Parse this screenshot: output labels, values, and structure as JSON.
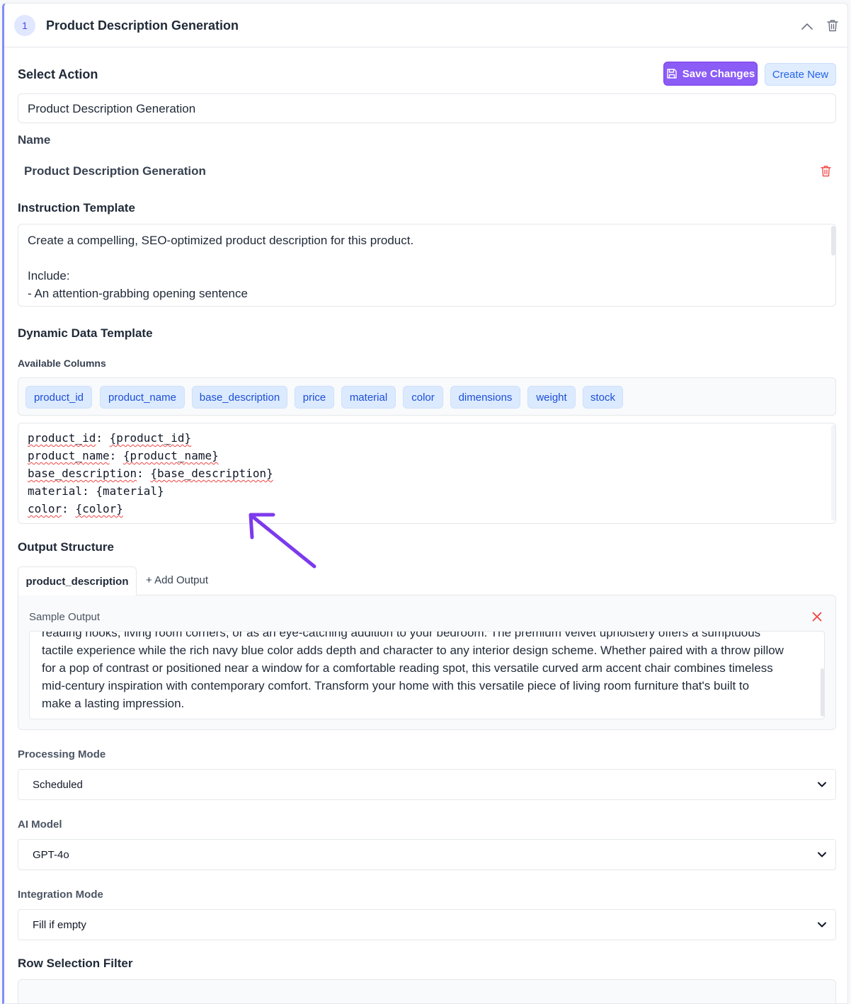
{
  "step": {
    "number": "1",
    "title": "Product Description Generation"
  },
  "select_action": {
    "label": "Select Action",
    "value": "Product Description Generation",
    "save_label": "Save Changes",
    "create_label": "Create New"
  },
  "name": {
    "label": "Name",
    "value": "Product Description Generation"
  },
  "instruction": {
    "label": "Instruction Template",
    "lines": [
      "Create a compelling, SEO-optimized product description for this product.",
      "",
      "Include:",
      "- An attention-grabbing opening sentence"
    ]
  },
  "dynamic": {
    "label": "Dynamic Data Template",
    "columns_label": "Available Columns",
    "columns": [
      "product_id",
      "product_name",
      "base_description",
      "price",
      "material",
      "color",
      "dimensions",
      "weight",
      "stock"
    ],
    "template_lines": [
      {
        "key": "product_id",
        "sep": ": ",
        "var": "{product_id}"
      },
      {
        "key": "product_name",
        "sep": ": ",
        "var": "{product_name}"
      },
      {
        "key": "base_description",
        "sep": ": ",
        "var": "{base_description}"
      },
      {
        "key": "material",
        "sep": ": ",
        "var": "{material}"
      },
      {
        "key": "color",
        "sep": ": ",
        "var": "{color}"
      }
    ]
  },
  "output": {
    "label": "Output Structure",
    "tab": "product_description",
    "add_label": "+ Add Output",
    "sample_label": "Sample Output",
    "sample_lines": [
      "reading nooks, living room corners, or as an eye-catching addition to your bedroom. The premium velvet upholstery offers a sumptuous",
      "tactile experience while the rich navy blue color adds depth and character to any interior design scheme. Whether paired with a throw pillow",
      "for a pop of contrast or positioned near a window for a comfortable reading spot, this versatile curved arm accent chair combines timeless",
      "mid-century inspiration with contemporary comfort. Transform your home with this versatile piece of living room furniture that's built to",
      "make a lasting impression."
    ]
  },
  "processing_mode": {
    "label": "Processing Mode",
    "value": "Scheduled"
  },
  "ai_model": {
    "label": "AI Model",
    "value": "GPT-4o"
  },
  "integration_mode": {
    "label": "Integration Mode",
    "value": "Fill if empty"
  },
  "row_filter": {
    "label": "Row Selection Filter"
  },
  "colors": {
    "accent": "#8b5cf6",
    "link": "#2563eb",
    "chip_bg": "#dbeafe",
    "danger": "#ef4444",
    "annotation_arrow": "#7c3aed"
  }
}
